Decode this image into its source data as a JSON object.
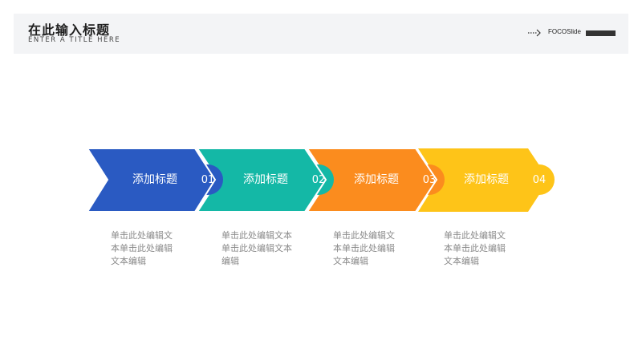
{
  "header": {
    "title": "在此输入标题",
    "subtitle": "ENTER A TITLE HERE",
    "brand": "FOCOSlide"
  },
  "colors": {
    "step1": "#2a5ac2",
    "step2": "#14b8a6",
    "step3": "#fb8c1e",
    "step4": "#fec418"
  },
  "steps": [
    {
      "label": "添加标题",
      "number": "01",
      "description": "单击此处编辑文本单击此处编辑文本编辑"
    },
    {
      "label": "添加标题",
      "number": "02",
      "description": "单击此处编辑文本单击此处编辑文本编辑"
    },
    {
      "label": "添加标题",
      "number": "03",
      "description": "单击此处编辑文本单击此处编辑文本编辑"
    },
    {
      "label": "添加标题",
      "number": "04",
      "description": "单击此处编辑文本单击此处编辑文本编辑"
    }
  ]
}
